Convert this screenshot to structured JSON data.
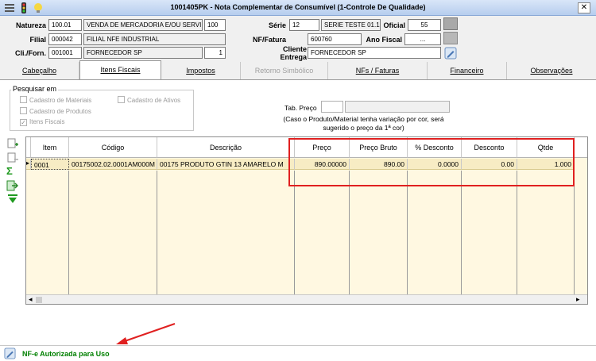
{
  "window": {
    "title": "1001405PK - Nota Complementar de Consumível (1-Controle De Qualidade)"
  },
  "header": {
    "natureza_label": "Natureza",
    "natureza_code": "100.01",
    "natureza_desc": "VENDA DE MERCADORIA E/OU SERVI",
    "natureza_extra": "100",
    "filial_label": "Filial",
    "filial_code": "000042",
    "filial_desc": "FILIAL NFE INDUSTRIAL",
    "cliforn_label": "Cli./Forn.",
    "cliforn_code": "001001",
    "cliforn_desc": "FORNECEDOR SP",
    "cliforn_extra": "1",
    "serie_label": "Série",
    "serie_code": "12",
    "serie_desc": "SERIE TESTE 01.1",
    "oficial_label": "Oficial",
    "oficial_value": "55",
    "nf_label": "NF/Fatura",
    "nf_value": "600760",
    "ano_label": "Ano Fiscal",
    "ano_value": "...",
    "cliente_label_1": "Cliente",
    "cliente_label_2": "Entrega",
    "cliente_value": "FORNECEDOR SP"
  },
  "tabs": [
    {
      "label": "Cabeçalho",
      "state": "normal"
    },
    {
      "label": "Itens Fiscais",
      "state": "active"
    },
    {
      "label": "Impostos",
      "state": "normal"
    },
    {
      "label": "Retorno Simbólico",
      "state": "disabled"
    },
    {
      "label": "NFs / Faturas",
      "state": "normal"
    },
    {
      "label": "Financeiro",
      "state": "normal"
    },
    {
      "label": "Observações",
      "state": "normal"
    }
  ],
  "search": {
    "group_title": "Pesquisar em",
    "opt_materiais": "Cadastro de Materiais",
    "opt_ativos": "Cadastro de Ativos",
    "opt_produtos": "Cadastro de Produtos",
    "opt_itens": "Itens Fiscais",
    "tab_preco_label": "Tab. Preço",
    "note_line1": "(Caso o Produto/Material tenha variação por cor, será",
    "note_line2": "sugerido o preço da 1ª cor)"
  },
  "grid": {
    "columns": [
      "Item",
      "Código",
      "Descrição",
      "Preço",
      "Preço Bruto",
      "% Desconto",
      "Desconto",
      "Qtde"
    ],
    "rows": [
      [
        "0001",
        "00175002.02.0001AM000M",
        "00175 PRODUTO GTIN 13 AMARELO M",
        "890.00000",
        "890.00",
        "0.0000",
        "0.00",
        "1.000"
      ]
    ]
  },
  "status": {
    "text": "NF-e Autorizada para Uso"
  },
  "colors": {
    "highlight_box": "#e02020",
    "status_text": "#008000",
    "arrow": "#e02020"
  }
}
